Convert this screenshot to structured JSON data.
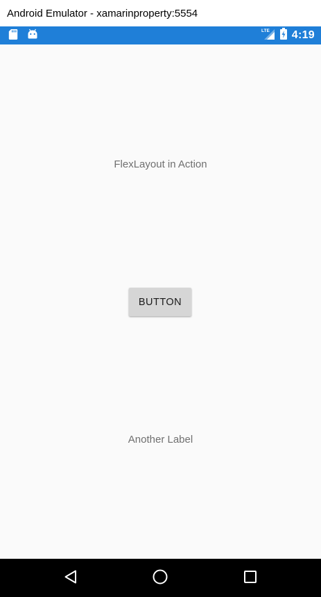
{
  "window": {
    "title": "Android Emulator - xamarinproperty:5554"
  },
  "status_bar": {
    "color": "#1f7fd8",
    "left_icons": [
      "sd-card-icon",
      "android-icon"
    ],
    "right_icons": [
      "lte-signal-icon",
      "battery-charging-icon"
    ],
    "network_label": "LTE",
    "time": "4:19"
  },
  "content": {
    "top_label": "FlexLayout in Action",
    "button_label": "BUTTON",
    "bottom_label": "Another Label"
  },
  "nav_bar": {
    "icons": [
      "back-icon",
      "home-icon",
      "recent-apps-icon"
    ]
  }
}
